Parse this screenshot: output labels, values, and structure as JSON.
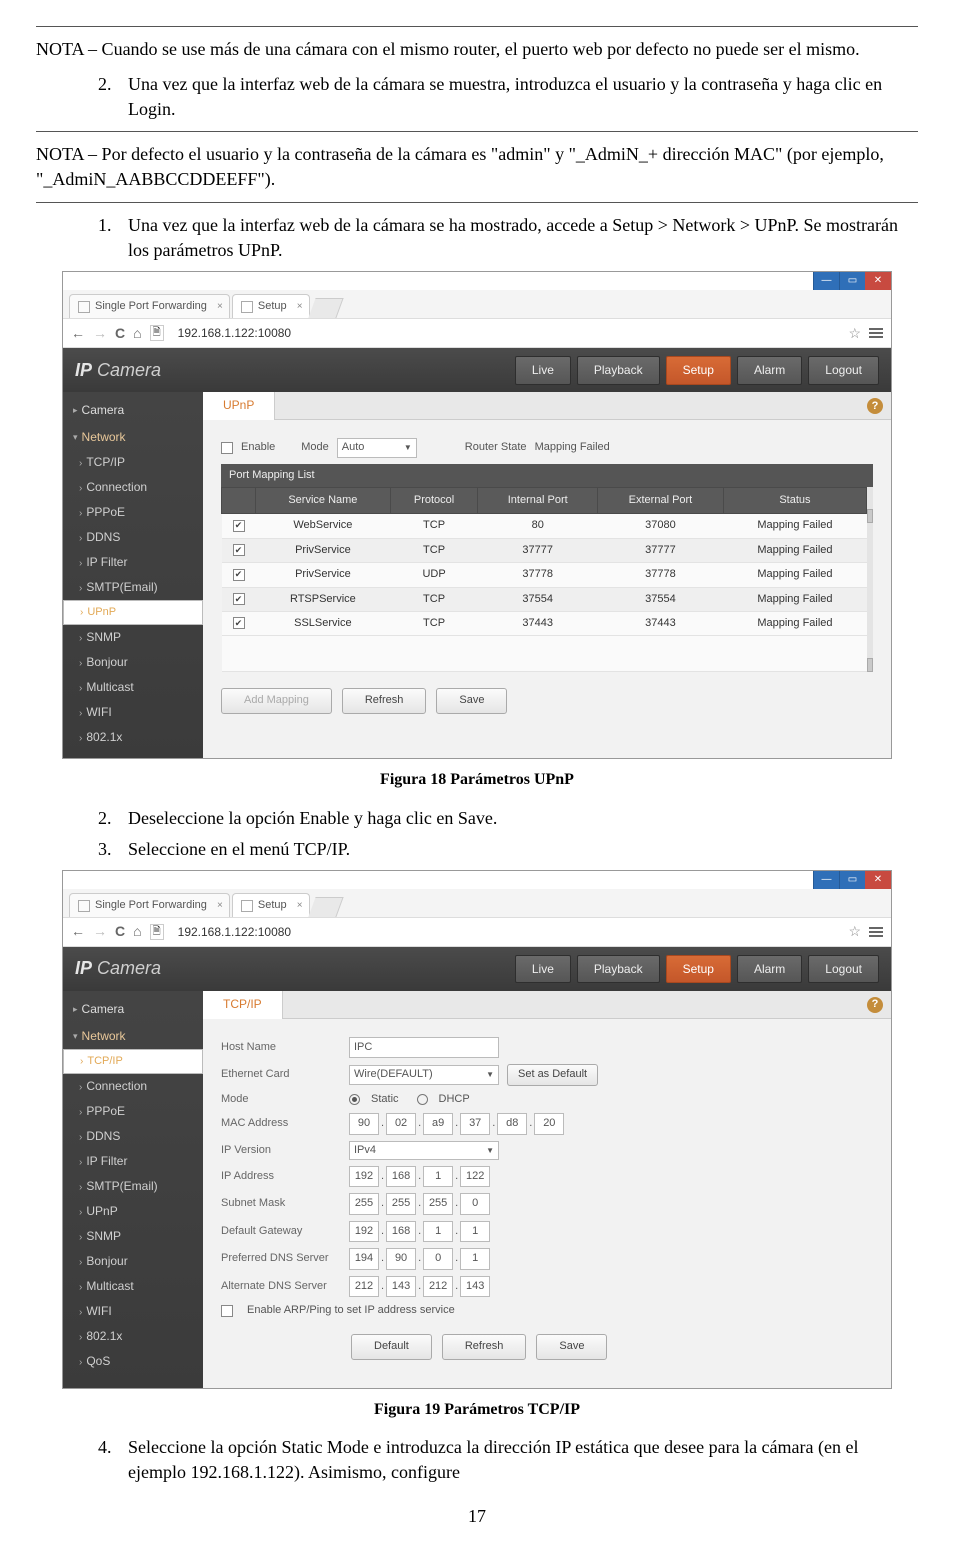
{
  "doc": {
    "nota1": "NOTA – Cuando se use más de una cámara con el mismo router, el puerto web por defecto no puede ser el mismo.",
    "step2": "Una vez que la interfaz web de la cámara se muestra, introduzca el usuario y la contraseña y haga clic en Login.",
    "nota2": "NOTA – Por defecto el usuario y la contraseña de la cámara es \"admin\" y \"_AdmiN_+ dirección MAC\" (por ejemplo, \"_AdmiN_AABBCCDDEEFF\").",
    "step1b": "Una vez que la interfaz web de la cámara se ha mostrado, accede a Setup > Network > UPnP. Se mostrarán los parámetros UPnP.",
    "caption18": "Figura 18 Parámetros UPnP",
    "step2b": "Deseleccione la opción Enable y haga clic en Save.",
    "step3b": "Seleccione en el menú TCP/IP.",
    "caption19": "Figura 19 Parámetros TCP/IP",
    "step4b": "Seleccione la opción Static Mode e introduzca la dirección IP estática que desee para la cámara (en el ejemplo 192.168.1.122). Asimismo, configure",
    "page": "17"
  },
  "shared": {
    "tab_spf": "Single Port Forwarding",
    "tab_setup": "Setup",
    "url": "192.168.1.122:10080",
    "brand_ip": "IP",
    "brand_cam": " Camera",
    "nav": {
      "live": "Live",
      "playback": "Playback",
      "setup": "Setup",
      "alarm": "Alarm",
      "logout": "Logout"
    },
    "side": {
      "camera": "Camera",
      "network": "Network",
      "tcpip": "TCP/IP",
      "conn": "Connection",
      "pppoe": "PPPoE",
      "ddns": "DDNS",
      "ipf": "IP Filter",
      "smtp": "SMTP(Email)",
      "upnp": "UPnP",
      "snmp": "SNMP",
      "bonj": "Bonjour",
      "multi": "Multicast",
      "wifi": "WIFI",
      "x8021": "802.1x",
      "qos": "QoS"
    }
  },
  "upnp": {
    "tab": "UPnP",
    "enable": "Enable",
    "mode": "Mode",
    "mode_val": "Auto",
    "router_state_lbl": "Router State",
    "router_state_val": "Mapping Failed",
    "pml": "Port Mapping List",
    "th": {
      "sn": "Service Name",
      "proto": "Protocol",
      "ip": "Internal Port",
      "ep": "External Port",
      "st": "Status"
    },
    "rows": [
      {
        "sn": "WebService",
        "p": "TCP",
        "ip": "80",
        "ep": "37080",
        "st": "Mapping Failed"
      },
      {
        "sn": "PrivService",
        "p": "TCP",
        "ip": "37777",
        "ep": "37777",
        "st": "Mapping Failed"
      },
      {
        "sn": "PrivService",
        "p": "UDP",
        "ip": "37778",
        "ep": "37778",
        "st": "Mapping Failed"
      },
      {
        "sn": "RTSPService",
        "p": "TCP",
        "ip": "37554",
        "ep": "37554",
        "st": "Mapping Failed"
      },
      {
        "sn": "SSLService",
        "p": "TCP",
        "ip": "37443",
        "ep": "37443",
        "st": "Mapping Failed"
      }
    ],
    "btn_add": "Add Mapping",
    "btn_ref": "Refresh",
    "btn_save": "Save"
  },
  "tcpip": {
    "tab": "TCP/IP",
    "host_lbl": "Host Name",
    "host_val": "IPC",
    "eth_lbl": "Ethernet Card",
    "eth_val": "Wire(DEFAULT)",
    "eth_btn": "Set as Default",
    "mode_lbl": "Mode",
    "mode_static": "Static",
    "mode_dhcp": "DHCP",
    "mac_lbl": "MAC Address",
    "mac": [
      "90",
      "02",
      "a9",
      "37",
      "d8",
      "20"
    ],
    "ipver_lbl": "IP Version",
    "ipver_val": "IPv4",
    "ipaddr_lbl": "IP Address",
    "ipaddr": [
      "192",
      "168",
      "1",
      "122"
    ],
    "subnet_lbl": "Subnet Mask",
    "subnet": [
      "255",
      "255",
      "255",
      "0"
    ],
    "gw_lbl": "Default Gateway",
    "gw": [
      "192",
      "168",
      "1",
      "1"
    ],
    "pdns_lbl": "Preferred DNS Server",
    "pdns": [
      "194",
      "90",
      "0",
      "1"
    ],
    "adns_lbl": "Alternate DNS Server",
    "adns": [
      "212",
      "143",
      "212",
      "143"
    ],
    "arp": "Enable ARP/Ping to set IP address service",
    "btn_def": "Default",
    "btn_ref": "Refresh",
    "btn_save": "Save"
  }
}
